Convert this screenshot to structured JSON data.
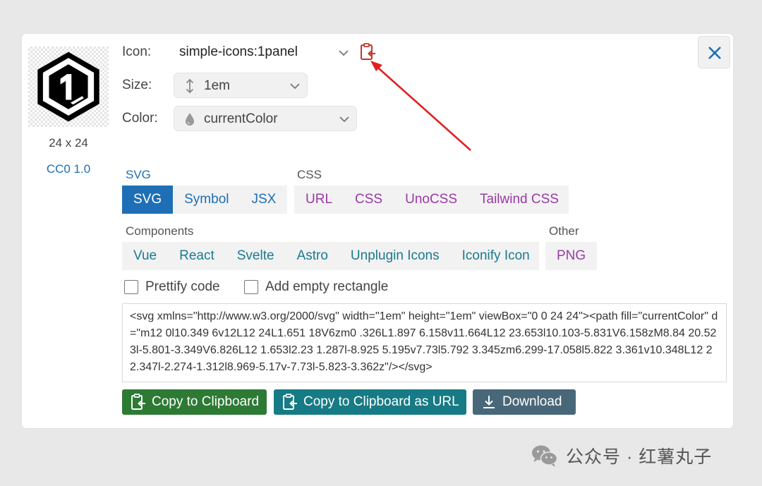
{
  "preview": {
    "dimensions": "24 x 24",
    "license": "CC0 1.0"
  },
  "props": {
    "icon_label": "Icon:",
    "icon_name": "simple-icons:1panel",
    "size_label": "Size:",
    "size_value": "1em",
    "color_label": "Color:",
    "color_value": "currentColor"
  },
  "svg_group": {
    "title": "SVG",
    "tabs": [
      "SVG",
      "Symbol",
      "JSX"
    ],
    "active": "SVG"
  },
  "css_group": {
    "title": "CSS",
    "tabs": [
      "URL",
      "CSS",
      "UnoCSS",
      "Tailwind CSS"
    ]
  },
  "components_group": {
    "title": "Components",
    "tabs": [
      "Vue",
      "React",
      "Svelte",
      "Astro",
      "Unplugin Icons",
      "Iconify Icon"
    ]
  },
  "other_group": {
    "title": "Other",
    "tabs": [
      "PNG"
    ]
  },
  "options": {
    "prettify": "Prettify code",
    "empty_rect": "Add empty rectangle"
  },
  "code": "<svg xmlns=\"http://www.w3.org/2000/svg\" width=\"1em\" height=\"1em\" viewBox=\"0 0 24 24\"><path fill=\"currentColor\" d=\"m12 0l10.349 6v12L12 24L1.651 18V6zm0 .326L1.897 6.158v11.664L12 23.653l10.103-5.831V6.158zM8.84 20.523l-5.801-3.349V6.826L12 1.653l2.23 1.287l-8.925 5.195v7.73l5.792 3.345zm6.299-17.058l5.822 3.361v10.348L12 22.347l-2.274-1.312l8.969-5.17v-7.73l-5.823-3.362z\"/></svg>",
  "actions": {
    "copy": "Copy to Clipboard",
    "copy_url": "Copy to Clipboard as URL",
    "download": "Download"
  },
  "watermark": "公众号 · 红薯丸子",
  "colors": {
    "primary": "#1e6fb5",
    "purple": "#9a3aa6",
    "teal": "#1a7a90",
    "green_button": "#2d7a34",
    "teal_button": "#177b85",
    "slate_button": "#486879",
    "annotation_red": "#e02020"
  },
  "icons": {
    "preview": "1panel-logo",
    "copy": "clipboard-copy-icon",
    "size": "vertical-arrows-icon",
    "color": "droplet-icon",
    "close": "close-icon",
    "download": "download-icon"
  }
}
